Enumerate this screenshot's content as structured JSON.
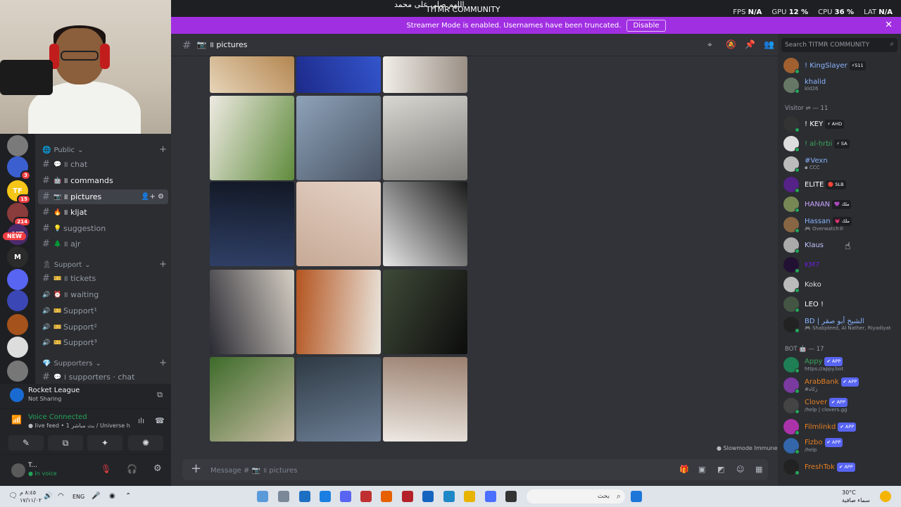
{
  "titlebar": {
    "title": "TITMR COMMUNITY",
    "arabic": "اللهم صلي على محمد",
    "stats": [
      {
        "label": "FPS",
        "value": "N/A"
      },
      {
        "label": "GPU",
        "value": "12 %"
      },
      {
        "label": "CPU",
        "value": "36 %"
      },
      {
        "label": "LAT",
        "value": "N/A"
      }
    ]
  },
  "banner": {
    "text": "Streamer Mode is enabled. Usernames have been truncated.",
    "button": "Disable",
    "close": "✕"
  },
  "rail": {
    "servers": [
      {
        "label": "",
        "color": "#7a7a7a"
      },
      {
        "label": "",
        "color": "#3b5fcf",
        "badge": "3"
      },
      {
        "label": "TF",
        "color": "#f5c518",
        "badge": "15"
      },
      {
        "label": "",
        "color": "#8a3b3b",
        "badge": "214"
      },
      {
        "label": "MT",
        "color": "#4b2a6b"
      },
      {
        "label": "M",
        "color": "#2b2b2b"
      },
      {
        "label": "",
        "color": "#5865f2"
      },
      {
        "label": "",
        "color": "#3b47b5"
      },
      {
        "label": "",
        "color": "#a5521c"
      },
      {
        "label": "",
        "color": "#dddddd"
      },
      {
        "label": "",
        "color": "#777777"
      }
    ],
    "new_badge": "NEW"
  },
  "channels": {
    "categories": [
      {
        "name": "Public",
        "emoji": "🌐"
      },
      {
        "name": "Support",
        "emoji": "🎗"
      },
      {
        "name": "Supporters",
        "emoji": "💎"
      }
    ],
    "public": [
      {
        "name": "॥ chat",
        "emoji": "💬",
        "state": "normal"
      },
      {
        "name": "॥ commands",
        "emoji": "🤖",
        "state": "bold"
      },
      {
        "name": "॥ pictures",
        "emoji": "📷",
        "state": "active"
      },
      {
        "name": "॥ kljat",
        "emoji": "🔥",
        "state": "bold"
      },
      {
        "name": "suggestion",
        "emoji": "💡",
        "state": "normal"
      },
      {
        "name": "॥ ajr",
        "emoji": "🌲",
        "state": "normal"
      }
    ],
    "support": [
      {
        "name": "॥ tickets",
        "emoji": "🎫",
        "type": "text"
      },
      {
        "name": "॥ waiting",
        "emoji": "⏰",
        "type": "voice"
      },
      {
        "name": "Support¹",
        "emoji": "🎫",
        "type": "voice"
      },
      {
        "name": "Support²",
        "emoji": "🎫",
        "type": "voice"
      },
      {
        "name": "Support³",
        "emoji": "🎫",
        "type": "voice"
      }
    ],
    "supporters": [
      {
        "name": "। supporters · chat",
        "emoji": "💬"
      }
    ]
  },
  "activity": {
    "game": "Rocket League",
    "status": "Not Sharing"
  },
  "voice": {
    "status": "Voice Connected",
    "channel": "● live feed • 1 بث مباشر / Universe hou..."
  },
  "user": {
    "name": "T...",
    "status": "● In voice"
  },
  "chat": {
    "channel": "॥ pictures",
    "placeholder": "Message # 📷 ॥ pictures",
    "slowmode": "● Slowmode Immune",
    "pictures": [
      {
        "name": "bread",
        "c1": "#e6d4b8",
        "c2": "#b48650"
      },
      {
        "name": "jersey",
        "c1": "#1d2a8a",
        "c2": "#3355cc"
      },
      {
        "name": "fur",
        "c1": "#f1eee8",
        "c2": "#9a8f85"
      },
      {
        "name": "cup",
        "c1": "#eeeae2",
        "c2": "#5f8b3c"
      },
      {
        "name": "airport",
        "c1": "#8ea2b8",
        "c2": "#4a5566"
      },
      {
        "name": "plane-seat",
        "c1": "#d8d7d2",
        "c2": "#7c7a76"
      },
      {
        "name": "car-night",
        "c1": "#121825",
        "c2": "#2f3f66"
      },
      {
        "name": "sand",
        "c1": "#e5d3c6",
        "c2": "#c7a996"
      },
      {
        "name": "flowers",
        "c1": "#1a1a1a",
        "c2": "#e8e8e8"
      },
      {
        "name": "room",
        "c1": "#d6cfc4",
        "c2": "#2a2a33"
      },
      {
        "name": "food",
        "c1": "#eae6de",
        "c2": "#b4541f"
      },
      {
        "name": "bowl",
        "c1": "#0c0c0c",
        "c2": "#3f4a38"
      },
      {
        "name": "garden",
        "c1": "#c9bda4",
        "c2": "#3d6b2a"
      },
      {
        "name": "sea",
        "c1": "#6d7f96",
        "c2": "#2e3a44"
      },
      {
        "name": "mall",
        "c1": "#ede9e3",
        "c2": "#9a7f6e"
      }
    ]
  },
  "members": {
    "search_placeholder": "Search TITMR COMMUNITY",
    "top": [
      {
        "name": "! KingSlayer",
        "tag": "⚡511",
        "color": "#8ab4ff",
        "sub": "",
        "av": "#a06030"
      },
      {
        "name": "khalid",
        "tag": "",
        "color": "#8ab4ff",
        "sub": "kld26",
        "av": "#667766"
      }
    ],
    "visitor_label": "Visitor ⇌ — 11",
    "visitors": [
      {
        "name": "! KEY",
        "tag": "⚡ AHD",
        "color": "#ffffff",
        "sub": "",
        "av": "#333333"
      },
      {
        "name": "! al-ḥrbi",
        "tag": "⚡ SA",
        "color": "#3ba55c",
        "sub": "",
        "av": "#dddddd"
      },
      {
        "name": "#Vexn",
        "tag": "",
        "color": "#8ab4ff",
        "sub": "▪ ꓚꓚꓚ",
        "av": "#bbbbbb"
      },
      {
        "name": "ELITE",
        "tag": "🔴 SLB",
        "color": "#ffffff",
        "sub": "",
        "av": "#552288"
      },
      {
        "name": "HANAN",
        "tag": "💜 ملك",
        "color": "#c6a4ff",
        "sub": "",
        "av": "#778855"
      },
      {
        "name": "Hassan",
        "tag": "💗 ملك",
        "color": "#8ab4ff",
        "sub": "🎮 Overwatch®",
        "av": "#886644"
      },
      {
        "name": "Klaus",
        "tag": "",
        "color": "#c6c6ff",
        "sub": "",
        "av": "#aaaaaa"
      },
      {
        "name": "KM7",
        "tag": "",
        "color": "#6a1fd1",
        "sub": "",
        "av": "#221133"
      },
      {
        "name": "Koko",
        "tag": "",
        "color": "#dddddd",
        "sub": "",
        "av": "#bbbbbb"
      },
      {
        "name": "LEO !",
        "tag": "",
        "color": "#ffffff",
        "sub": "",
        "av": "#445544"
      },
      {
        "name": "BD | الشيخ أبو صقر",
        "tag": "",
        "color": "#8ab4ff",
        "sub": "🎮 Shabjdeed, Al Nather, Riyadiyat",
        "av": "#222222"
      }
    ],
    "bot_label": "BOT 🤖 — 17",
    "bots": [
      {
        "name": "Appy",
        "tag": "✔ APP",
        "color": "#3ba55c",
        "sub": "https://appy.bot",
        "av": "#1f7f55"
      },
      {
        "name": "ArabBank",
        "tag": "✔ APP",
        "color": "#e67e22",
        "sub": "#زكاة",
        "av": "#7a3aa0"
      },
      {
        "name": "Clover",
        "tag": "✔ APP",
        "color": "#e67e22",
        "sub": "/help | clovers.gg",
        "av": "#444444"
      },
      {
        "name": "Filmlinkd",
        "tag": "✔ APP",
        "color": "#e67e22",
        "sub": "",
        "av": "#aa33aa"
      },
      {
        "name": "Fizbo",
        "tag": "✔ APP",
        "color": "#e67e22",
        "sub": "/help",
        "av": "#3366aa"
      },
      {
        "name": "FreshTok",
        "tag": "✔ APP",
        "color": "#e67e22",
        "sub": "",
        "av": "#222222"
      }
    ]
  },
  "taskbar": {
    "lang": "ENG",
    "time": "٨:٤٥ م",
    "date": "١٧/١١/٠٢",
    "search": "بحث",
    "weather_temp": "30°C",
    "weather_text": "سماء صافية"
  }
}
